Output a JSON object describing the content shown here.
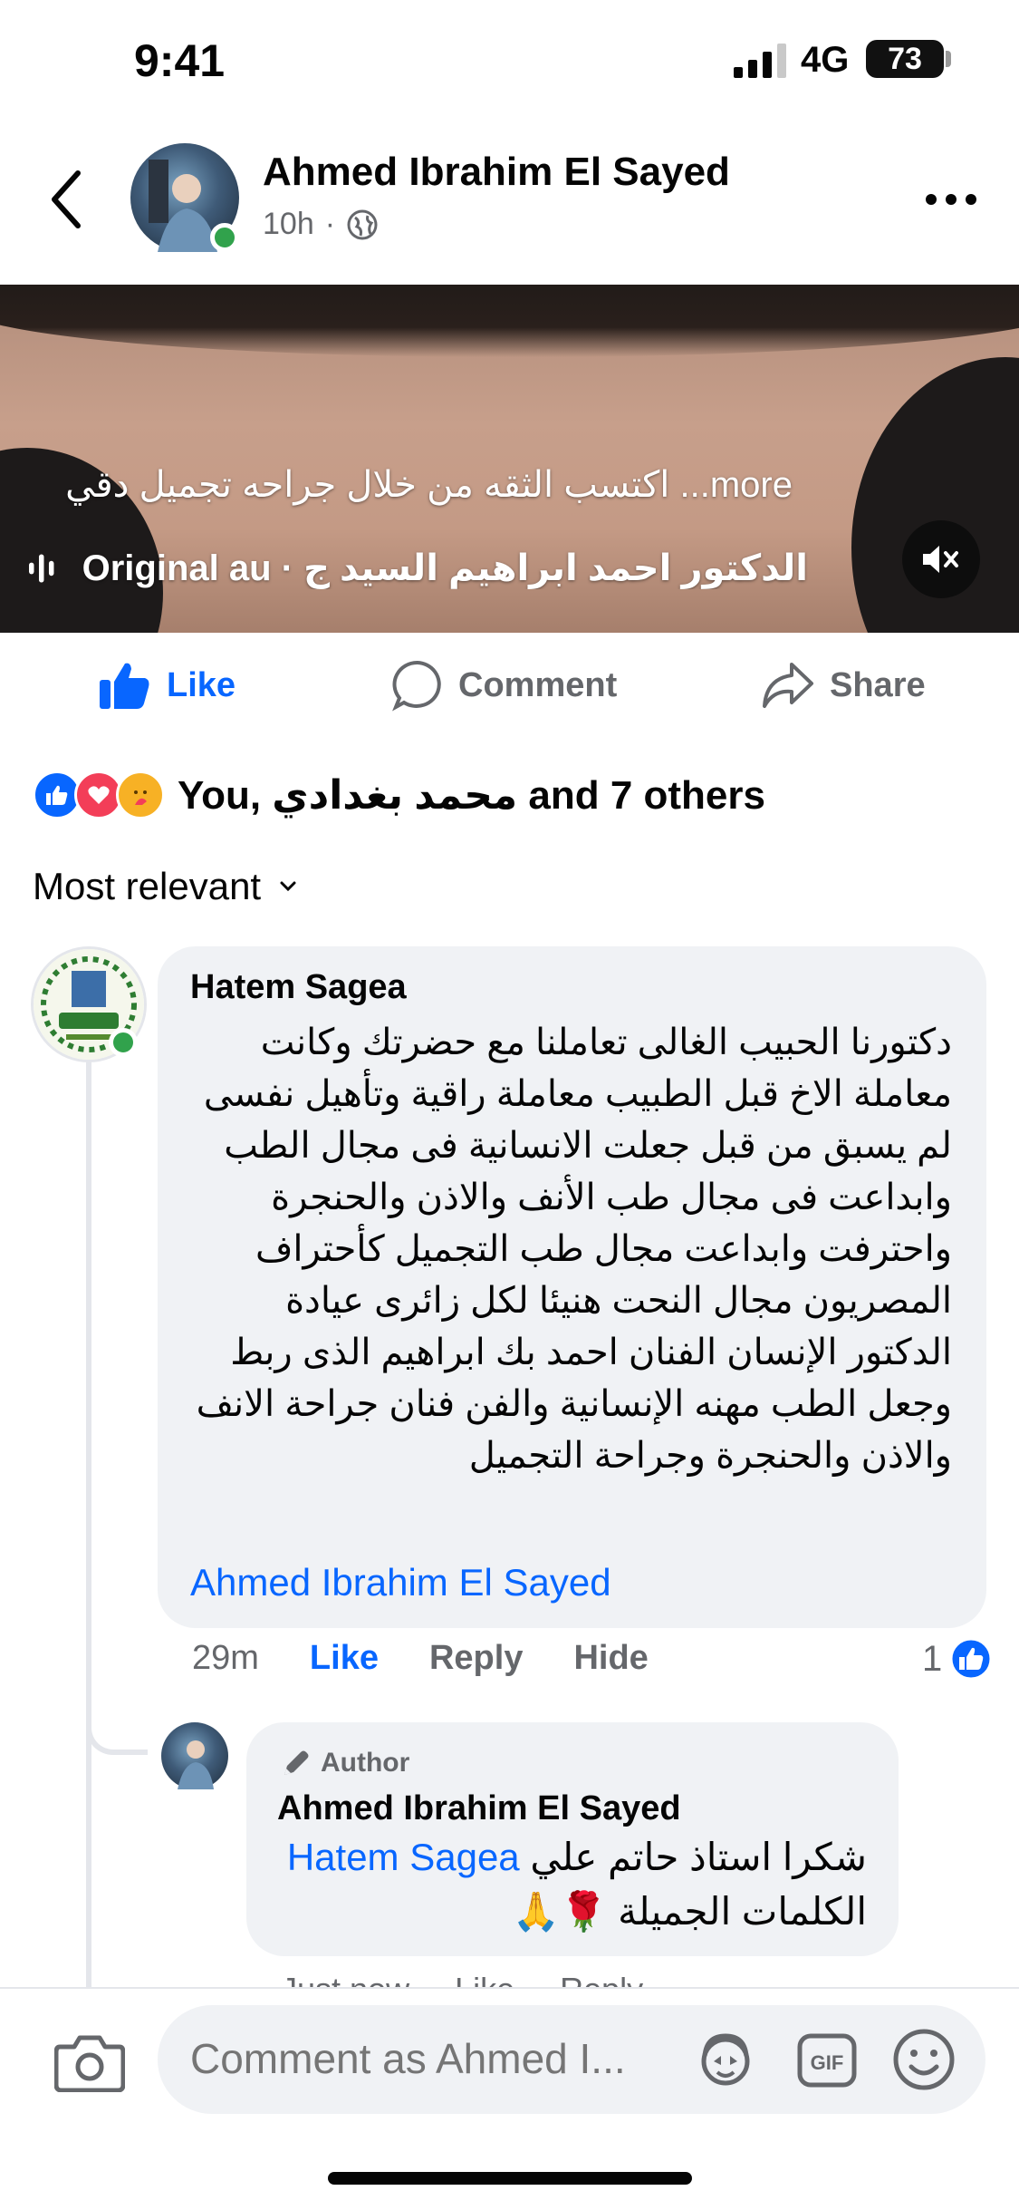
{
  "status_bar": {
    "time": "9:41",
    "network": "4G",
    "battery": "73"
  },
  "post": {
    "author": "Ahmed Ibrahim El Sayed",
    "time": "10h",
    "separator": "·",
    "media": {
      "caption": "اكتسب الثقه من خلال جراحه تجميل دقي ...more",
      "audio": "الدكتور احمد ابراهيم السيد ج · Original au"
    },
    "actions": {
      "like": "Like",
      "comment": "Comment",
      "share": "Share"
    },
    "reactions_text": "You, محمد بغدادي and 7 others",
    "sort": "Most relevant"
  },
  "comments": [
    {
      "name": "Hatem Sagea",
      "text": "دكتورنا الحبيب الغالى تعاملنا مع حضرتك وكانت معاملة الاخ قبل الطبيب معاملة راقية وتأهيل نفسى لم يسبق من قبل جعلت الانسانية فى مجال الطب وابداعت فى مجال طب الأنف والاذن والحنجرة واحترفت  وابداعت مجال طب التجميل كأحتراف المصريون مجال النحت هنيئا لكل زائرى عيادة الدكتور الإنسان الفنان احمد بك ابراهيم الذى ربط وجعل الطب مهنه الإنسانية والفن فنان جراحة الانف والاذن والحنجرة وجراحة التجميل",
      "tag": "Ahmed Ibrahim El Sayed",
      "time": "29m",
      "like": "Like",
      "reply": "Reply",
      "hide": "Hide",
      "reaction_count": "1"
    }
  ],
  "reply": {
    "badge": "Author",
    "name": "Ahmed Ibrahim El Sayed",
    "text_before": "شكرا استاذ حاتم علي",
    "mention": "Hatem Sagea",
    "text_line2": "الكلمات الجميلة 🌹🙏",
    "time": "Just now",
    "like": "Like",
    "reply": "Reply"
  },
  "composer": {
    "placeholder": "Comment as Ahmed I..."
  },
  "colors": {
    "accent": "#0866ff",
    "online": "#31a24c",
    "bubble": "#f0f2f5",
    "muted": "#65676b"
  },
  "icons": [
    "back-arrow-icon",
    "globe-icon",
    "more-dots-icon",
    "audio-wave-icon",
    "mute-icon",
    "like-icon",
    "comment-icon",
    "share-icon",
    "chevron-down-icon",
    "pen-icon",
    "camera-icon",
    "avatar-sticker-icon",
    "gif-icon",
    "emoji-icon"
  ]
}
